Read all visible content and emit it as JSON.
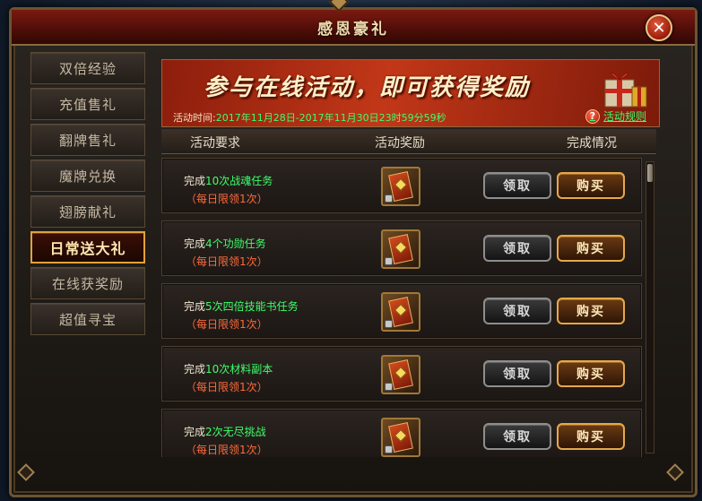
{
  "window": {
    "title": "感恩豪礼",
    "close_label": "✕"
  },
  "menu": {
    "items": [
      {
        "label": "双倍经验",
        "active": false
      },
      {
        "label": "充值售礼",
        "active": false
      },
      {
        "label": "翻牌售礼",
        "active": false
      },
      {
        "label": "魔牌兑换",
        "active": false
      },
      {
        "label": "翅膀献礼",
        "active": false
      },
      {
        "label": "日常送大礼",
        "active": true
      },
      {
        "label": "在线获奖励",
        "active": false
      },
      {
        "label": "超值寻宝",
        "active": false
      }
    ]
  },
  "banner": {
    "slogan": "参与在线活动，即可获得奖励",
    "time_label": "活动时间:",
    "time_value": "2017年11月28日-2017年11月30日23时59分59秒",
    "rules_label": "活动规则",
    "help_icon": "?"
  },
  "table": {
    "headers": [
      "活动要求",
      "活动奖励",
      "完成情况"
    ],
    "rows": [
      {
        "prefix": "完成",
        "count": "10次战魂任务",
        "limit": "（每日限领1次）",
        "claim": "领取",
        "buy": "购买"
      },
      {
        "prefix": "完成",
        "count": "4个功勋任务",
        "limit": "（每日限领1次）",
        "claim": "领取",
        "buy": "购买"
      },
      {
        "prefix": "完成",
        "count": "5次四倍技能书任务",
        "limit": "（每日限领1次）",
        "claim": "领取",
        "buy": "购买"
      },
      {
        "prefix": "完成",
        "count": "10次材料副本",
        "limit": "（每日限领1次）",
        "claim": "领取",
        "buy": "购买"
      },
      {
        "prefix": "完成",
        "count": "2次无尽挑战",
        "limit": "（每日限领1次）",
        "claim": "领取",
        "buy": "购买"
      }
    ]
  },
  "colors": {
    "accent": "#e2a23a",
    "highlight_text": "#3cff6a",
    "limit_text": "#ff6a3a"
  }
}
